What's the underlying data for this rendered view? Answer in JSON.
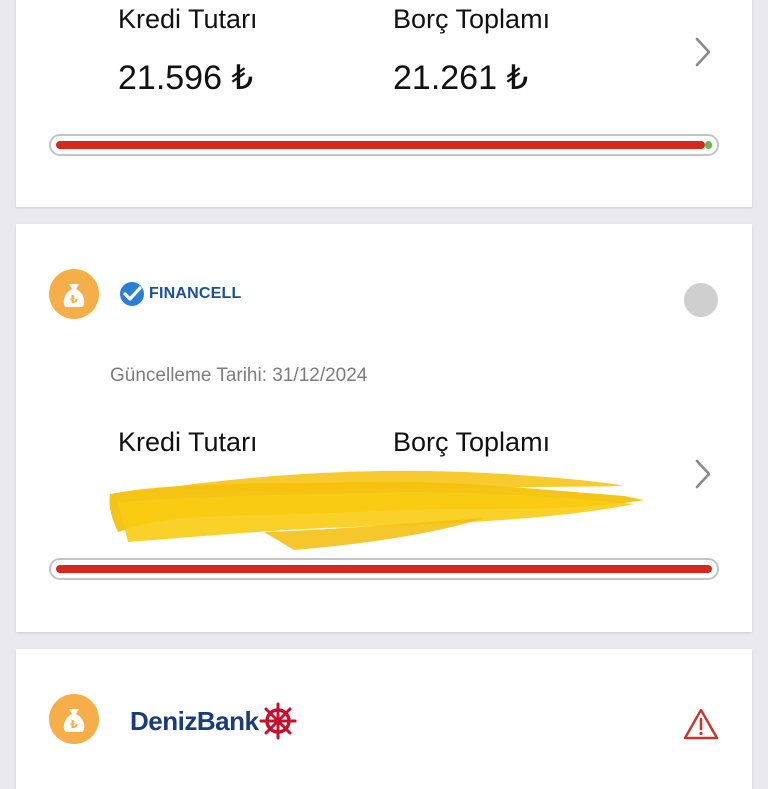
{
  "cards": [
    {
      "credit_label": "Kredi Tutarı",
      "credit_value": "21.596 ₺",
      "debt_label": "Borç Toplamı",
      "debt_value": "21.261 ₺",
      "progress_fraction": 0.985,
      "icon": "chevron-right-icon"
    },
    {
      "bank_name": "FINANCELL",
      "bank_logo_icon": "financell-check-icon",
      "avatar_icon": "money-bag-lira-icon",
      "status": "inactive-gray-dot",
      "update_label": "Güncelleme Tarihi: 31/12/2024",
      "credit_label": "Kredi Tutarı",
      "debt_label": "Borç Toplamı",
      "values_redacted": true,
      "progress_fraction": 1.0,
      "icon": "chevron-right-icon"
    },
    {
      "bank_name": "DenizBank",
      "bank_logo_icon": "ship-wheel-icon",
      "avatar_icon": "money-bag-lira-icon",
      "status_icon": "warning-triangle-icon"
    }
  ],
  "colors": {
    "progress_red": "#d32a1d",
    "progress_green": "#63b944",
    "avatar_orange": "#f6ae49",
    "warning_red": "#c8362b",
    "financell_blue": "#1b4f9c",
    "denizbank_navy": "#1a3b7c",
    "denizbank_red": "#c8102e"
  }
}
